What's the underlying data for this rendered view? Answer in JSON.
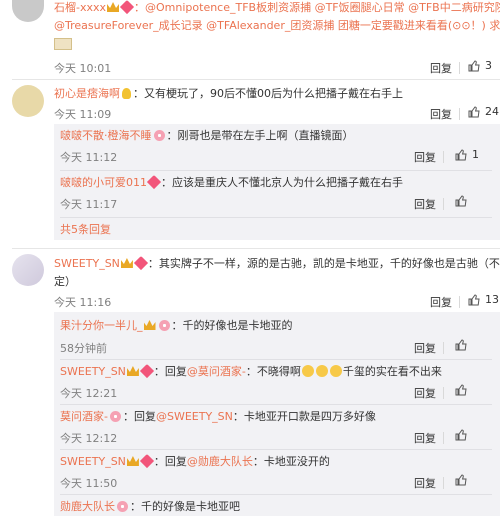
{
  "c1": {
    "line1_pre": "石榴-xxxx",
    "line1_text": "：@Omnipotence_TFB板刺资源捕 @TF饭圈腿心日常 @TFB中二病研究院",
    "line2_text": "@TreasureForever_成长记录 @TFAlexander_团资源捕 团糖一定要戳进来看看(⊙⊙！) 求转发",
    "time": "今天 10:01",
    "reply": "回复",
    "likes": "3"
  },
  "c2": {
    "name": "初心是痞海啊",
    "text": "：又有梗玩了，90后不懂00后为什么把播子戴在右手上",
    "time": "今天 11:09",
    "reply": "回复",
    "likes": "24",
    "subs": [
      {
        "name": "啵啵不散·橙海不睡",
        "text": "：刚哥也是带在左手上啊（直播镜面）",
        "time": "今天 11:12",
        "reply": "回复",
        "likes": "1"
      },
      {
        "name": "啵啵的小可爱011",
        "text": "：应该是重庆人不懂北京人为什么把播子戴在右手",
        "time": "今天 11:17",
        "reply": "回复",
        "likes": ""
      }
    ],
    "more": "共5条回复"
  },
  "c3": {
    "name": "SWEETY_SN",
    "text1": "：其实牌子不一样，源的是古驰，凯的是卡地亚，千的好像也是古驰（不太确",
    "text2": "定）",
    "time": "今天 11:16",
    "reply": "回复",
    "likes": "13",
    "subs": [
      {
        "name": "果汁分你一半儿_",
        "text": "：千的好像也是卡地亚的",
        "time": "58分钟前",
        "reply": "回复",
        "likes": ""
      },
      {
        "name": "SWEETY_SN",
        "text_pre": "：回复",
        "mention": "@莫问酒家-",
        "text": "：不晓得啊",
        "text_post": "千玺的实在看不出来",
        "time": "今天 12:21",
        "reply": "回复",
        "likes": ""
      },
      {
        "name": "莫问酒家-",
        "text_pre": "：回复",
        "mention": "@SWEETY_SN",
        "text": "：卡地亚开口款是四万多好像",
        "time": "今天 12:12",
        "reply": "回复",
        "likes": ""
      },
      {
        "name": "SWEETY_SN",
        "text_pre": "：回复",
        "mention": "@勋鹿大队长",
        "text": "：卡地亚没开的",
        "time": "今天 11:50",
        "reply": "回复",
        "likes": ""
      },
      {
        "name": "勋鹿大队长",
        "text": "：千的好像是卡地亚吧",
        "time": "",
        "reply": "",
        "likes": ""
      }
    ]
  }
}
